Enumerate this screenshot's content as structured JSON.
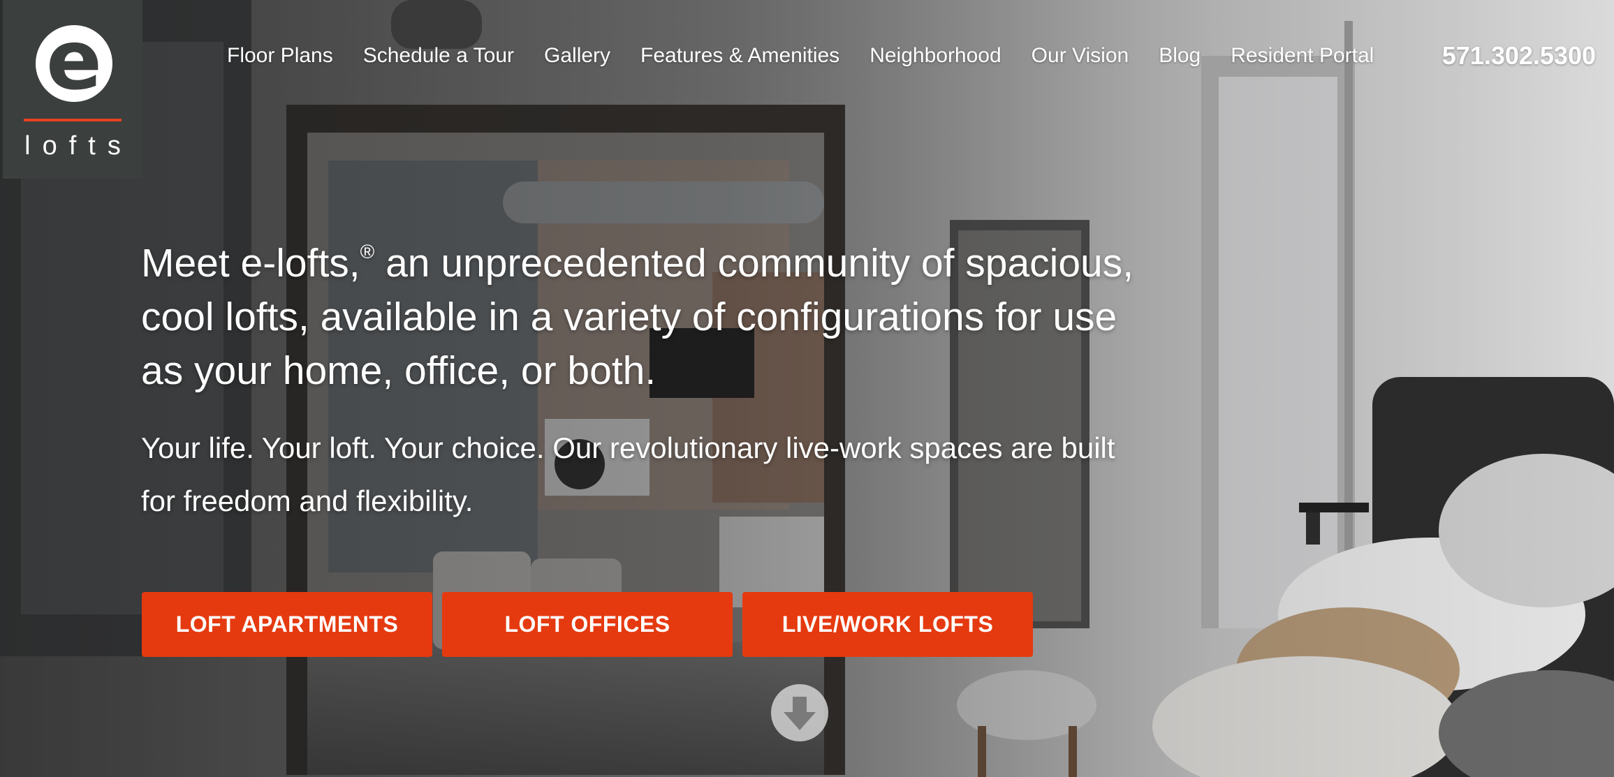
{
  "site": {
    "logo": {
      "letter": "e",
      "word": "lofts",
      "accent": "#e8421f"
    }
  },
  "nav": {
    "items": [
      "Floor Plans",
      "Schedule a Tour",
      "Gallery",
      "Features & Amenities",
      "Neighborhood",
      "Our Vision",
      "Blog",
      "Resident Portal"
    ],
    "phone": "571.302.5300"
  },
  "hero": {
    "headline_pre": "Meet e-lofts,",
    "headline_mark": "®",
    "headline_post": " an unprecedented community of spacious, cool lofts, available in a variety of configurations for use as your home, office, or both.",
    "subline": "Your life. Your loft. Your choice. Our revolutionary live-work spaces are built for freedom and flexibility.",
    "buttons": [
      "LOFT APARTMENTS",
      "LOFT OFFICES",
      "LIVE/WORK LOFTS"
    ],
    "button_color": "#e53a10",
    "scroll_icon": "arrow-down-circle-icon"
  }
}
